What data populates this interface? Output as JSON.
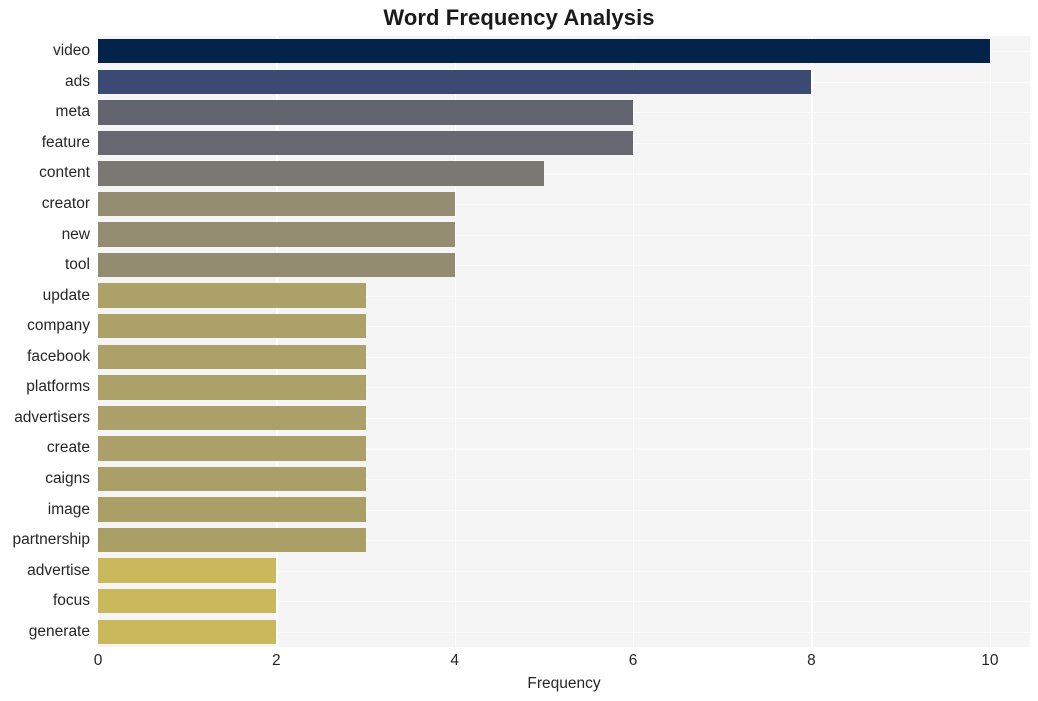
{
  "chart_data": {
    "type": "bar",
    "orientation": "horizontal",
    "title": "Word Frequency Analysis",
    "xlabel": "Frequency",
    "ylabel": "",
    "categories": [
      "video",
      "ads",
      "meta",
      "feature",
      "content",
      "creator",
      "new",
      "tool",
      "update",
      "company",
      "facebook",
      "platforms",
      "advertisers",
      "create",
      "caigns",
      "image",
      "partnership",
      "advertise",
      "focus",
      "generate"
    ],
    "values": [
      10,
      8,
      6,
      6,
      5,
      4,
      4,
      4,
      3,
      3,
      3,
      3,
      3,
      3,
      3,
      3,
      3,
      2,
      2,
      2
    ],
    "bar_colors": [
      "#04234b",
      "#3a4a72",
      "#63656e",
      "#666771",
      "#7a7872",
      "#948d72",
      "#948d71",
      "#938c70",
      "#aca169",
      "#aca169",
      "#aca169",
      "#aca169",
      "#aba069",
      "#aba069",
      "#ab9f68",
      "#ab9f68",
      "#aa9e67",
      "#c9b85c",
      "#c9b85c",
      "#c9b85c"
    ],
    "xlim": [
      0,
      10.45
    ],
    "xticks": [
      0,
      2,
      4,
      6,
      8,
      10
    ],
    "xticklabels": [
      "0",
      "2",
      "4",
      "6",
      "8",
      "10"
    ],
    "grid": true,
    "grid_color": "#ffffff",
    "plot_background": "#f5f5f5",
    "figure_background": "#ffffff",
    "legend": null
  }
}
